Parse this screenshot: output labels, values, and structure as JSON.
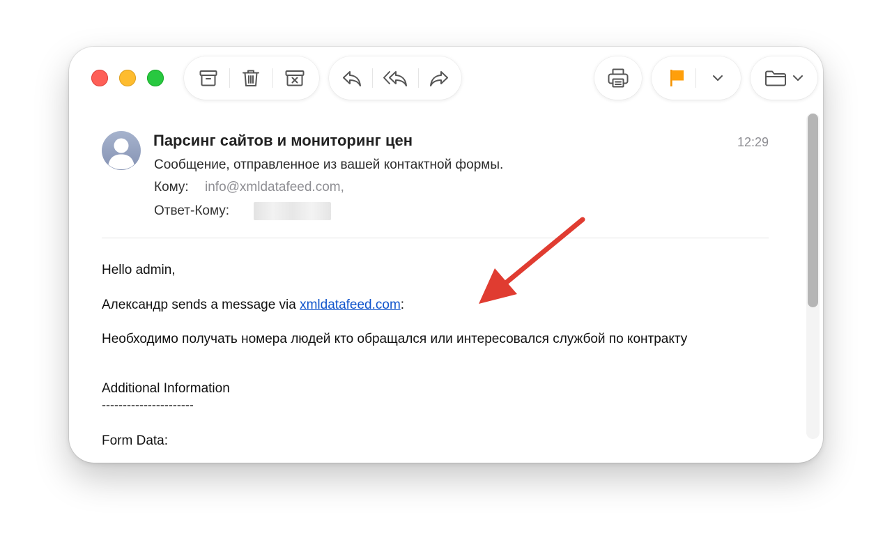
{
  "toolbar": {
    "icons": [
      "archive-icon",
      "trash-icon",
      "junk-icon",
      "reply-icon",
      "reply-all-icon",
      "forward-icon",
      "print-icon",
      "flag-icon",
      "chevron-down-icon",
      "folder-icon"
    ],
    "flag_color": "#ff9500"
  },
  "email": {
    "subject": "Парсинг сайтов и мониторинг цен",
    "time": "12:29",
    "summary": "Сообщение, отправленное из вашей контактной формы.",
    "to_label": "Кому:",
    "to_value": "info@xmldatafeed.com,",
    "reply_to_label": "Ответ-Кому:",
    "body": {
      "greeting": "Hello admin,",
      "sender_prefix": "Александр sends a message via ",
      "link": "xmldatafeed.com",
      "sender_suffix": ":",
      "message": "Необходимо получать номера людей кто обращался или интересовался службой по контракту",
      "additional_heading": "Additional Information",
      "separator": "----------------------",
      "form_data": "Form Data:"
    }
  },
  "colors": {
    "annotation_arrow": "#e03c31",
    "link": "#1155cc",
    "close": "#fe5f57",
    "minimize": "#febc2e",
    "maximize": "#28c840"
  }
}
